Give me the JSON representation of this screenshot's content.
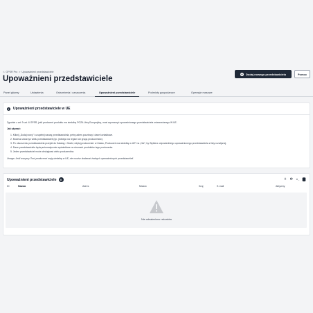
{
  "breadcrumb": {
    "home": "GPSR Pro",
    "separator": ">",
    "current": "Upoważnieni przedstawiciele"
  },
  "header": {
    "title": "Upoważnieni przedstawiciele",
    "primary_button": "Dodaj nowego przedstawiciela",
    "secondary_button": "Pomoc"
  },
  "tabs": [
    {
      "label": "Panel główny"
    },
    {
      "label": "Ustawienia"
    },
    {
      "label": "Ostrzeżenia i oznaczenia"
    },
    {
      "label": "Upoważnieni przedstawiciele",
      "active": true
    },
    {
      "label": "Podmioty gospodarcze"
    },
    {
      "label": "Operacje masowe"
    }
  ],
  "info": {
    "title": "Upoważnieni przedstawiciele w UE",
    "intro": "Zgodnie z art. 9 ust. 6 GPSR, jeśli producent produktu ma siedzibę POZA Unią Europejską, musi wyznaczyć upoważnionego przedstawiciela ustanowionego W UE.",
    "how_title": "Jak używać:",
    "steps": [
      "1. Kliknij „Dodaj nowy” i uzupełnij nazwę przedstawiciela, pełny adres pocztowy i dane kontaktowe.",
      "2. Możesz utworzyć wielu przedstawicieli (np. jednego na region lub grupę producentów).",
      "3. Po utworzeniu przedstawiciela przejdź do Katalog > Marki, edytuj producenta i w Ustaw „Producent ma siedzibę w UE” na „Nie”, by Wybierz odpowiedniego upoważnionego przedstawiciela z listy rozwijanej.",
      "4. Dane przedstawiciela będą automatycznie wyświetlane na stronach produktów tego producenta.",
      "5. Jeden przedstawiciel może obsługiwać wielu producentów."
    ],
    "note": "Uwaga: Jeśli wszyscy Twoi producenci mają siedzibę w UE, nie musisz dodawać żadnych upoważnionych przedstawicieli."
  },
  "list": {
    "title": "Upoważnieni przedstawiciele",
    "count": "0",
    "icons": {
      "add": "plus-icon",
      "refresh": "refresh-icon",
      "sql": "sql-icon",
      "export": "database-icon"
    },
    "columns": [
      "ID",
      "Nazwa",
      "Adres",
      "Miasto",
      "Kraj",
      "E-mail",
      "Aktywny"
    ],
    "empty_text": "Nie odnaleziono rekordów"
  }
}
